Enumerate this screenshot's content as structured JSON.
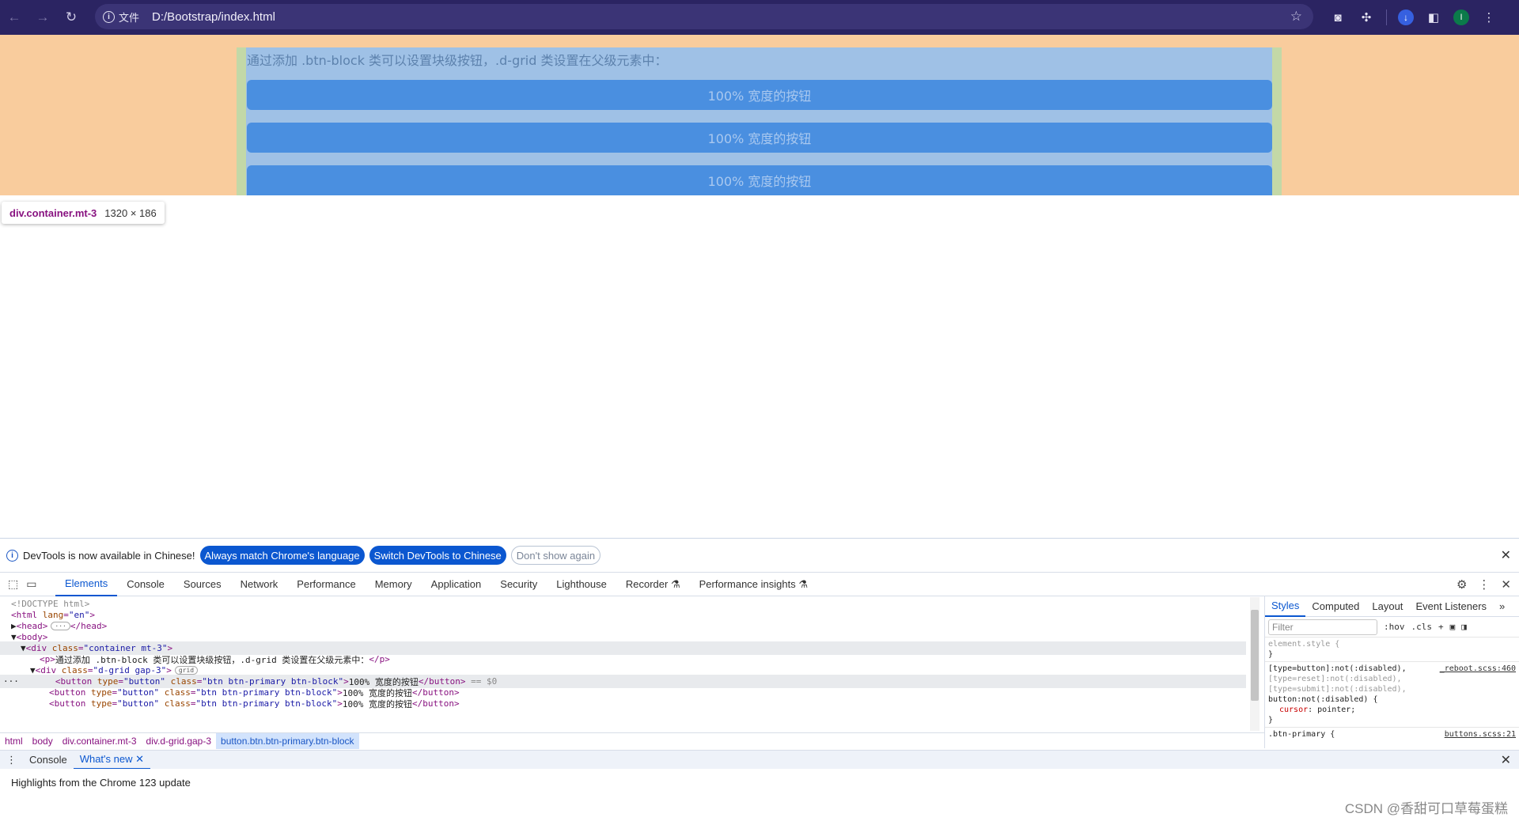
{
  "browser": {
    "chip_label": "文件",
    "url": "D:/Bootstrap/index.html",
    "colors": {
      "frame": "#2b2462",
      "omnibox": "#3b3476"
    }
  },
  "page": {
    "paragraph": "通过添加 .btn-block 类可以设置块级按钮，.d-grid 类设置在父级元素中：",
    "buttons": [
      "100% 宽度的按钮",
      "100% 宽度的按钮",
      "100% 宽度的按钮"
    ],
    "tooltip": {
      "selector": "div.container.mt-3",
      "size": "1320 × 186"
    },
    "colors": {
      "margin": "#f9cc9d",
      "padding": "#c3d8a7",
      "content": "#9fc1e6",
      "button": "#4a8fe0"
    }
  },
  "devtools": {
    "infobar": {
      "message": "DevTools is now available in Chinese!",
      "always_match": "Always match Chrome's language",
      "switch": "Switch DevTools to Chinese",
      "dont_show": "Don't show again"
    },
    "tabs": [
      "Elements",
      "Console",
      "Sources",
      "Network",
      "Performance",
      "Memory",
      "Application",
      "Security",
      "Lighthouse",
      "Recorder ⚗",
      "Performance insights ⚗"
    ],
    "dom": {
      "doctype": "<!DOCTYPE html>",
      "html_open_tag": "<html",
      "lang_attr": "lang",
      "lang_val": "\"en\"",
      "close_gt": ">",
      "head": "<head>",
      "head_dots": "···",
      "head_close": "</head>",
      "body": "<body>",
      "div_open": "<div",
      "class_attr": "class",
      "container_val": "\"container mt-3\"",
      "p_open": "<p>",
      "p_text": "通过添加 .btn-block 类可以设置块级按钮，.d-grid 类设置在父级元素中：",
      "p_close": "</p>",
      "grid_val": "\"d-grid gap-3\"",
      "grid_badge": "grid",
      "btn_open": "<button",
      "type_attr": "type",
      "type_val": "\"button\"",
      "btn_class_val": "\"btn btn-primary btn-block\"",
      "btn_text": "100% 宽度的按钮",
      "btn_close": "</button>",
      "dollar": " == $0",
      "ellipsis": "···"
    },
    "breadcrumbs": [
      "html",
      "body",
      "div.container.mt-3",
      "div.d-grid.gap-3",
      "button.btn.btn-primary.btn-block"
    ],
    "styles": {
      "tabs": [
        "Styles",
        "Computed",
        "Layout",
        "Event Listeners"
      ],
      "filter_placeholder": "Filter",
      "hov": ":hov",
      "cls": ".cls",
      "element_style": "element.style {",
      "brace_close": "}",
      "sel1": "[type=button]:not(:disabled),",
      "sel1_source": "_reboot.scss:460",
      "sel2": "[type=reset]:not(:disabled),",
      "sel3": "[type=submit]:not(:disabled),",
      "sel4": "button:not(:disabled) {",
      "prop_name": "cursor",
      "prop_value": ": pointer;",
      "sel5": ".btn-primary {",
      "sel5_source": "buttons.scss:21"
    },
    "drawer": {
      "tabs": [
        "Console",
        "What's new"
      ],
      "headline": "Highlights from the Chrome 123 update"
    },
    "watermark": "CSDN @香甜可口草莓蛋糕"
  }
}
